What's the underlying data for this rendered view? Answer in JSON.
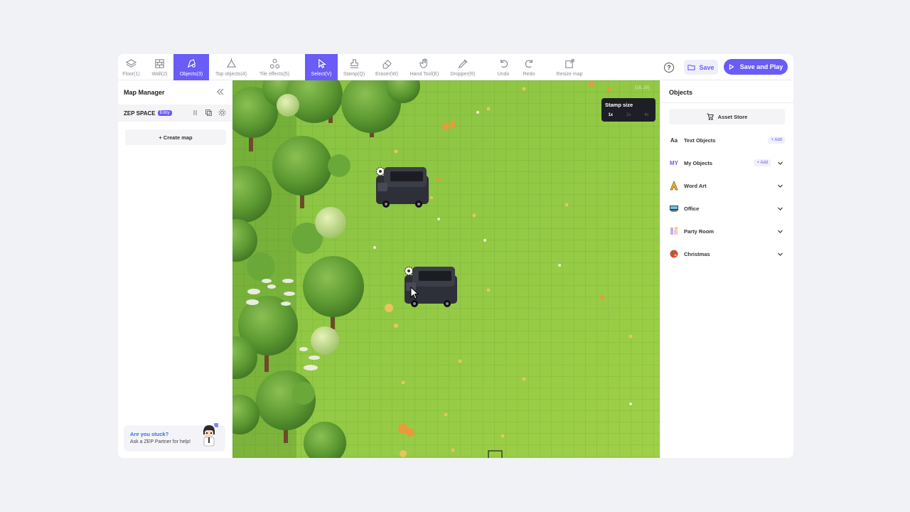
{
  "toolbar": {
    "tools": [
      {
        "id": "floor",
        "label": "Floor(1)",
        "active": false
      },
      {
        "id": "wall",
        "label": "Wall(2)",
        "active": false
      },
      {
        "id": "objects",
        "label": "Objects(3)",
        "active": true
      },
      {
        "id": "top-objects",
        "label": "Top objects(4)",
        "active": false
      },
      {
        "id": "tile-effects",
        "label": "Tile effects(5)",
        "active": false
      },
      {
        "id": "select",
        "label": "Select(V)",
        "active": true
      },
      {
        "id": "stamp",
        "label": "Stamp(Q)",
        "active": false
      },
      {
        "id": "eraser",
        "label": "Eraser(W)",
        "active": false
      },
      {
        "id": "hand-tool",
        "label": "Hand Tool(E)",
        "active": false
      },
      {
        "id": "dropper",
        "label": "Dropper(R)",
        "active": false
      },
      {
        "id": "undo",
        "label": "Undo",
        "active": false
      },
      {
        "id": "redo",
        "label": "Redo",
        "active": false
      },
      {
        "id": "resize-map",
        "label": "Resize map",
        "active": false
      }
    ],
    "help_label": "?",
    "save_label": "Save",
    "save_play_label": "Save and Play"
  },
  "map_manager": {
    "title": "Map Manager",
    "space_name": "ZEP SPACE",
    "entry_badge": "Entry",
    "create_map_label": "+ Create map"
  },
  "help_card": {
    "title": "Are you stuck?",
    "subtitle": "Ask a ZEP Partner for help!"
  },
  "map": {
    "stamp_size_title": "Stamp size",
    "stamp_options": [
      "1x",
      "2x",
      "4x"
    ],
    "stamp_selected": "1x",
    "coords": "(18, 28)"
  },
  "objects_panel": {
    "title": "Objects",
    "asset_store_label": "Asset Store",
    "categories": [
      {
        "icon_text": "Aa",
        "label": "Text Objects",
        "add": "+ Add",
        "expand": false
      },
      {
        "icon_text": "MY",
        "label": "My Objects",
        "add": "+ Add",
        "expand": true
      },
      {
        "icon_text": "",
        "label": "Word Art",
        "add": "",
        "expand": true
      },
      {
        "icon_text": "",
        "label": "Office",
        "add": "",
        "expand": true
      },
      {
        "icon_text": "",
        "label": "Party Room",
        "add": "",
        "expand": true
      },
      {
        "icon_text": "",
        "label": "Christmas",
        "add": "",
        "expand": true
      }
    ]
  },
  "colors": {
    "accent": "#6a5cf6",
    "grass": "#8cc63f",
    "tree": "#5e9a2e"
  }
}
